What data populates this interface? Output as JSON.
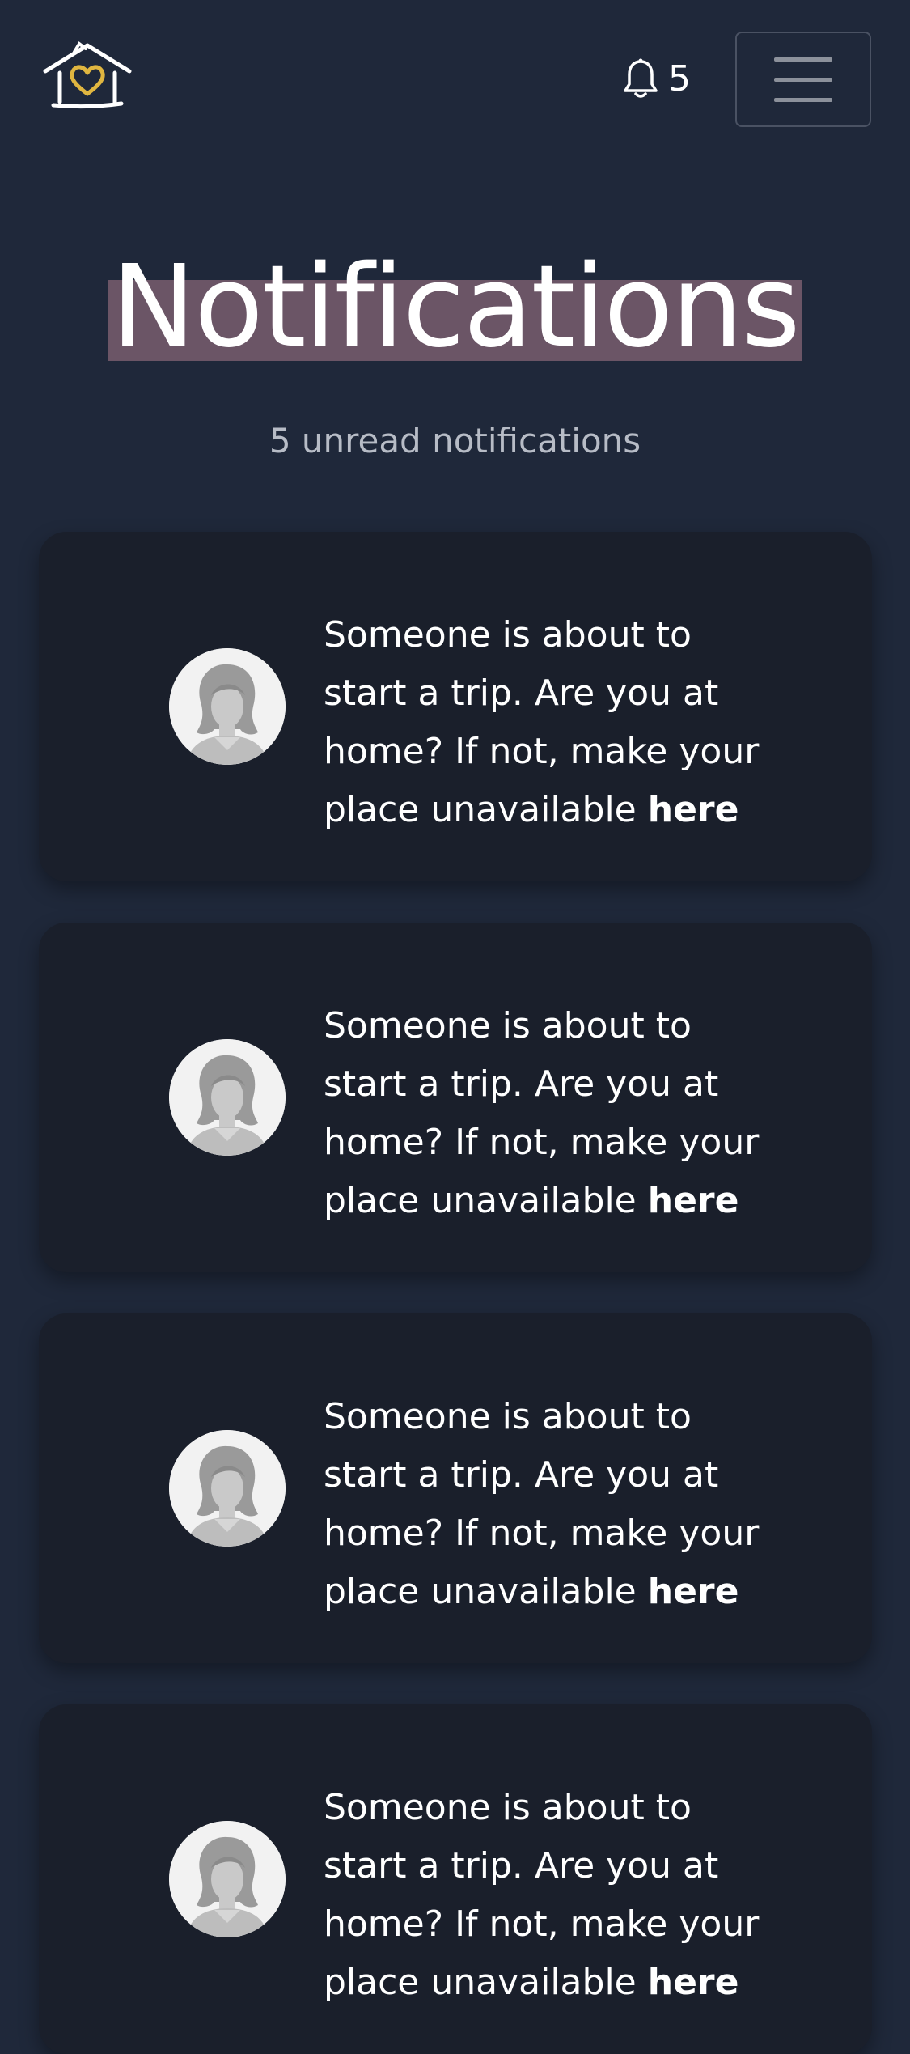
{
  "header": {
    "logo_icon": "house-heart-icon",
    "notification_count": "5",
    "bell_icon": "bell-icon",
    "menu_icon": "hamburger-menu-icon"
  },
  "page": {
    "title": "Notifications",
    "subtitle": "5 unread notifications"
  },
  "notifications": [
    {
      "message": "Someone is about to start a trip. Are you at home? If not, make your place unavailable",
      "link_text": "here",
      "avatar_icon": "default-user-avatar"
    },
    {
      "message": "Someone is about to start a trip. Are you at home? If not, make your place unavailable",
      "link_text": "here",
      "avatar_icon": "default-user-avatar"
    },
    {
      "message": "Someone is about to start a trip. Are you at home? If not, make your place unavailable",
      "link_text": "here",
      "avatar_icon": "default-user-avatar"
    },
    {
      "message": "Someone is about to start a trip. Are you at home? If not, make your place unavailable",
      "link_text": "here",
      "avatar_icon": "default-user-avatar"
    }
  ],
  "colors": {
    "background": "#1f283a",
    "card": "#1a1f2b",
    "title_highlight": "#6b5566",
    "logo_heart": "#e0b640"
  }
}
